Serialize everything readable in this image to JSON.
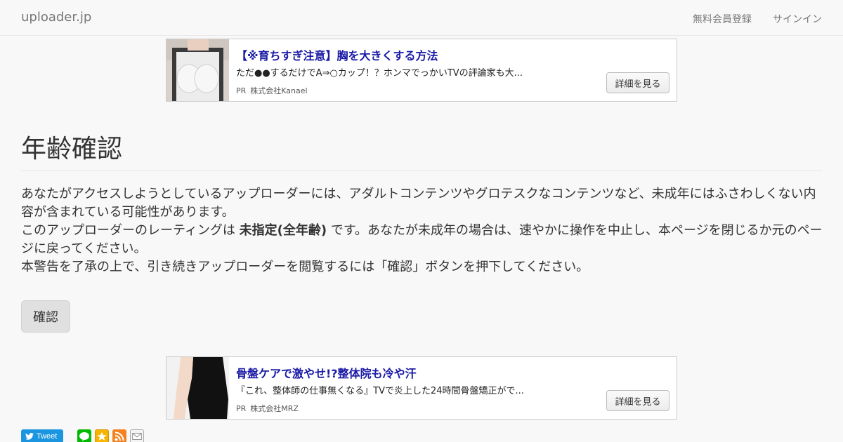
{
  "navbar": {
    "brand": "uploader.jp",
    "links": [
      "無料会員登録",
      "サインイン"
    ]
  },
  "ads": [
    {
      "title": "【※育ちすぎ注意】胸を大きくする方法",
      "description": "ただ●●するだけでA⇒○カップ！？ホンマでっかいTVの評論家も大...",
      "pr": "PR",
      "advertiser": "株式会社Kanael",
      "button": "詳細を見る"
    },
    {
      "title": "骨盤ケアで激やせ!?整体院も冷や汗",
      "description": "『これ、整体師の仕事無くなる』TVで炎上した24時間骨盤矯正がで...",
      "pr": "PR",
      "advertiser": "株式会社MRZ",
      "button": "詳細を見る"
    }
  ],
  "main": {
    "title": "年齢確認",
    "paragraph1": "あなたがアクセスしようとしているアップローダーには、アダルトコンテンツやグロテスクなコンテンツなど、未成年にはふさわしくない内容が含まれている可能性があります。",
    "paragraph2_pre": "このアップローダーのレーティングは ",
    "paragraph2_rating": "未指定(全年齢)",
    "paragraph2_post": " です。あなたが未成年の場合は、速やかに操作を中止し、本ページを閉じるか元のページに戻ってください。",
    "paragraph3": "本警告を了承の上で、引き続きアップローダーを閲覧するには「確認」ボタンを押下してください。",
    "confirm_button": "確認"
  },
  "share": {
    "tweet_label": "Tweet"
  },
  "colors": {
    "ad_title": "#1a1aa6",
    "tweet": "#1b95e0",
    "line": "#00b900",
    "star": "#f5b400",
    "rss": "#f58220"
  }
}
